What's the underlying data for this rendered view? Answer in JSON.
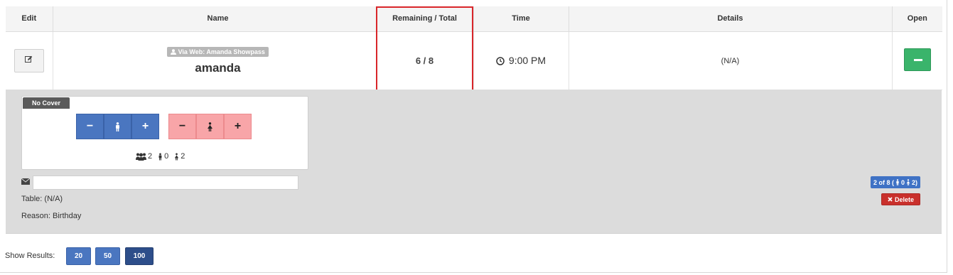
{
  "table": {
    "headers": {
      "edit": "Edit",
      "name": "Name",
      "remaining": "Remaining / Total",
      "time": "Time",
      "details": "Details",
      "open": "Open"
    },
    "row": {
      "via": "Via Web: Amanda Showpass",
      "name": "amanda",
      "remaining": "6 / 8",
      "time": "9:00 PM",
      "details": "(N/A)"
    }
  },
  "panel": {
    "cover_label": "No Cover",
    "counts": {
      "total": "2",
      "male": "0",
      "female": "2"
    },
    "table_text": "Table: (N/A)",
    "reason_text": "Reason: Birthday",
    "badge": {
      "prefix": "2 of 8 (",
      "male": "0",
      "female": "2)"
    },
    "delete_label": "Delete"
  },
  "pagination": {
    "label": "Show Results:",
    "options": [
      "20",
      "50",
      "100"
    ],
    "selected": "100"
  },
  "colors": {
    "highlight": "#d9262a",
    "open_button": "#3ab46b",
    "male_button": "#4a76c0",
    "female_button": "#f8a5a8",
    "delete_button": "#c9302c"
  }
}
